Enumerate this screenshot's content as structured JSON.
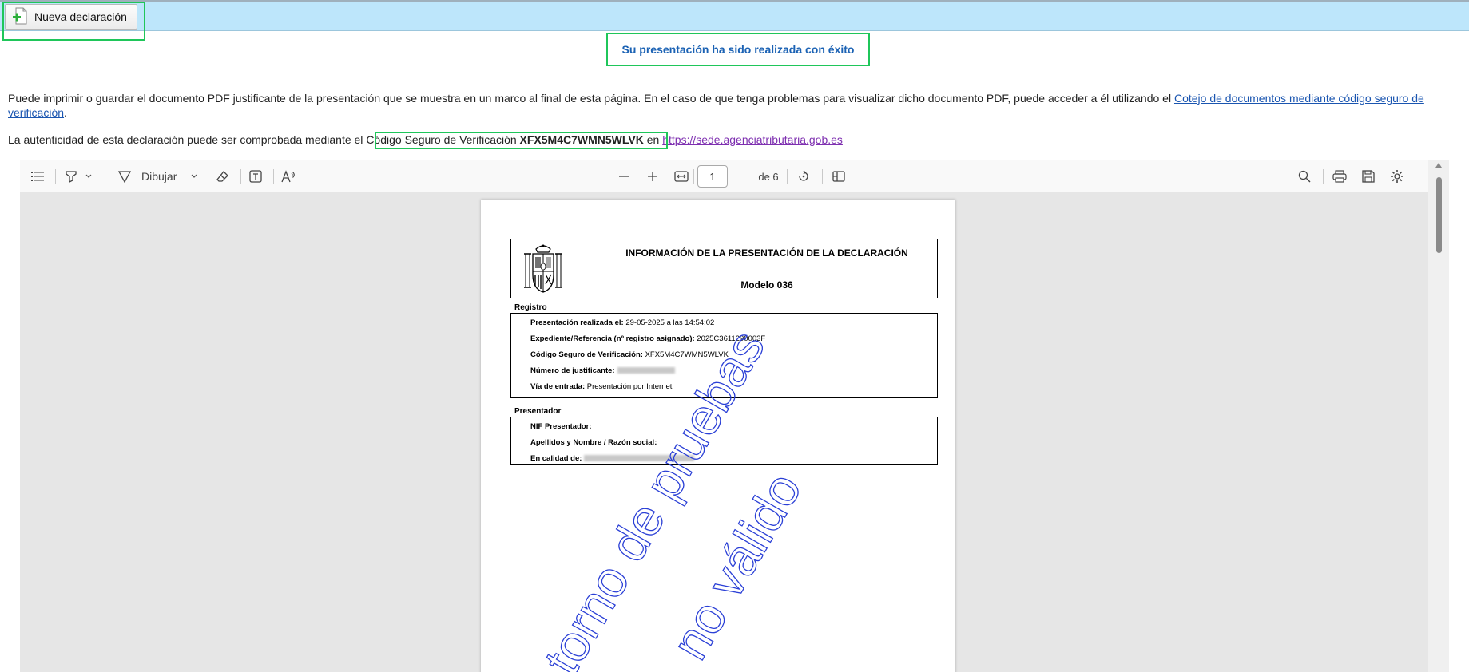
{
  "topbar": {
    "new_button_label": "Nueva declaración"
  },
  "success_message": "Su presentación ha sido realizada con éxito",
  "info": {
    "text1_before": "Puede imprimir o guardar el documento PDF justificante de la presentación que se muestra en un marco al final de esta página. En el caso de que tenga problemas para visualizar dicho documento PDF, puede acceder a él utilizando el ",
    "cotejo_link": "Cotejo de documentos mediante código seguro de verificación",
    "text1_after": ".",
    "text2_before": "La autenticidad de esta declaración puede ser comprobada mediante el ",
    "csv_label": "Código Seguro de Verificación",
    "csv_code": "XFX5M4C7WMN5WLVK",
    "text2_mid": " en ",
    "sede_link": "https://sede.agenciatributaria.gob.es"
  },
  "viewer": {
    "draw_label": "Dibujar",
    "page_current": "1",
    "page_total": "de 6"
  },
  "pdf": {
    "title": "INFORMACIÓN DE LA PRESENTACIÓN DE LA DECLARACIÓN",
    "model": "Modelo 036",
    "registro_label": "Registro",
    "fields": {
      "presentacion_label": "Presentación realizada el:",
      "presentacion_value": "29-05-2025 a las 14:54:02",
      "expediente_label": "Expediente/Referencia (nº registro asignado):",
      "expediente_value": "2025C3611290003F",
      "csv_label": "Código Seguro de Verificación:",
      "csv_value": "XFX5M4C7WMN5WLVK",
      "justificante_label": "Número de justificante:",
      "via_label": "Vía de entrada:",
      "via_value": "Presentación por Internet"
    },
    "presentador_label": "Presentador",
    "presentador": {
      "nif_label": "NIF Presentador:",
      "nombre_label": "Apellidos y Nombre / Razón social:",
      "calidad_label": "En calidad de:"
    },
    "watermark_line1": "torno de pruebas",
    "watermark_line2": "no válido"
  },
  "colors": {
    "topbar_bg": "#bde6fb",
    "highlight": "#1fc65a",
    "success_text": "#1b62b4",
    "link": "#1a55b0",
    "visited_link": "#7e2fb0",
    "watermark": "#2a3fd6"
  }
}
